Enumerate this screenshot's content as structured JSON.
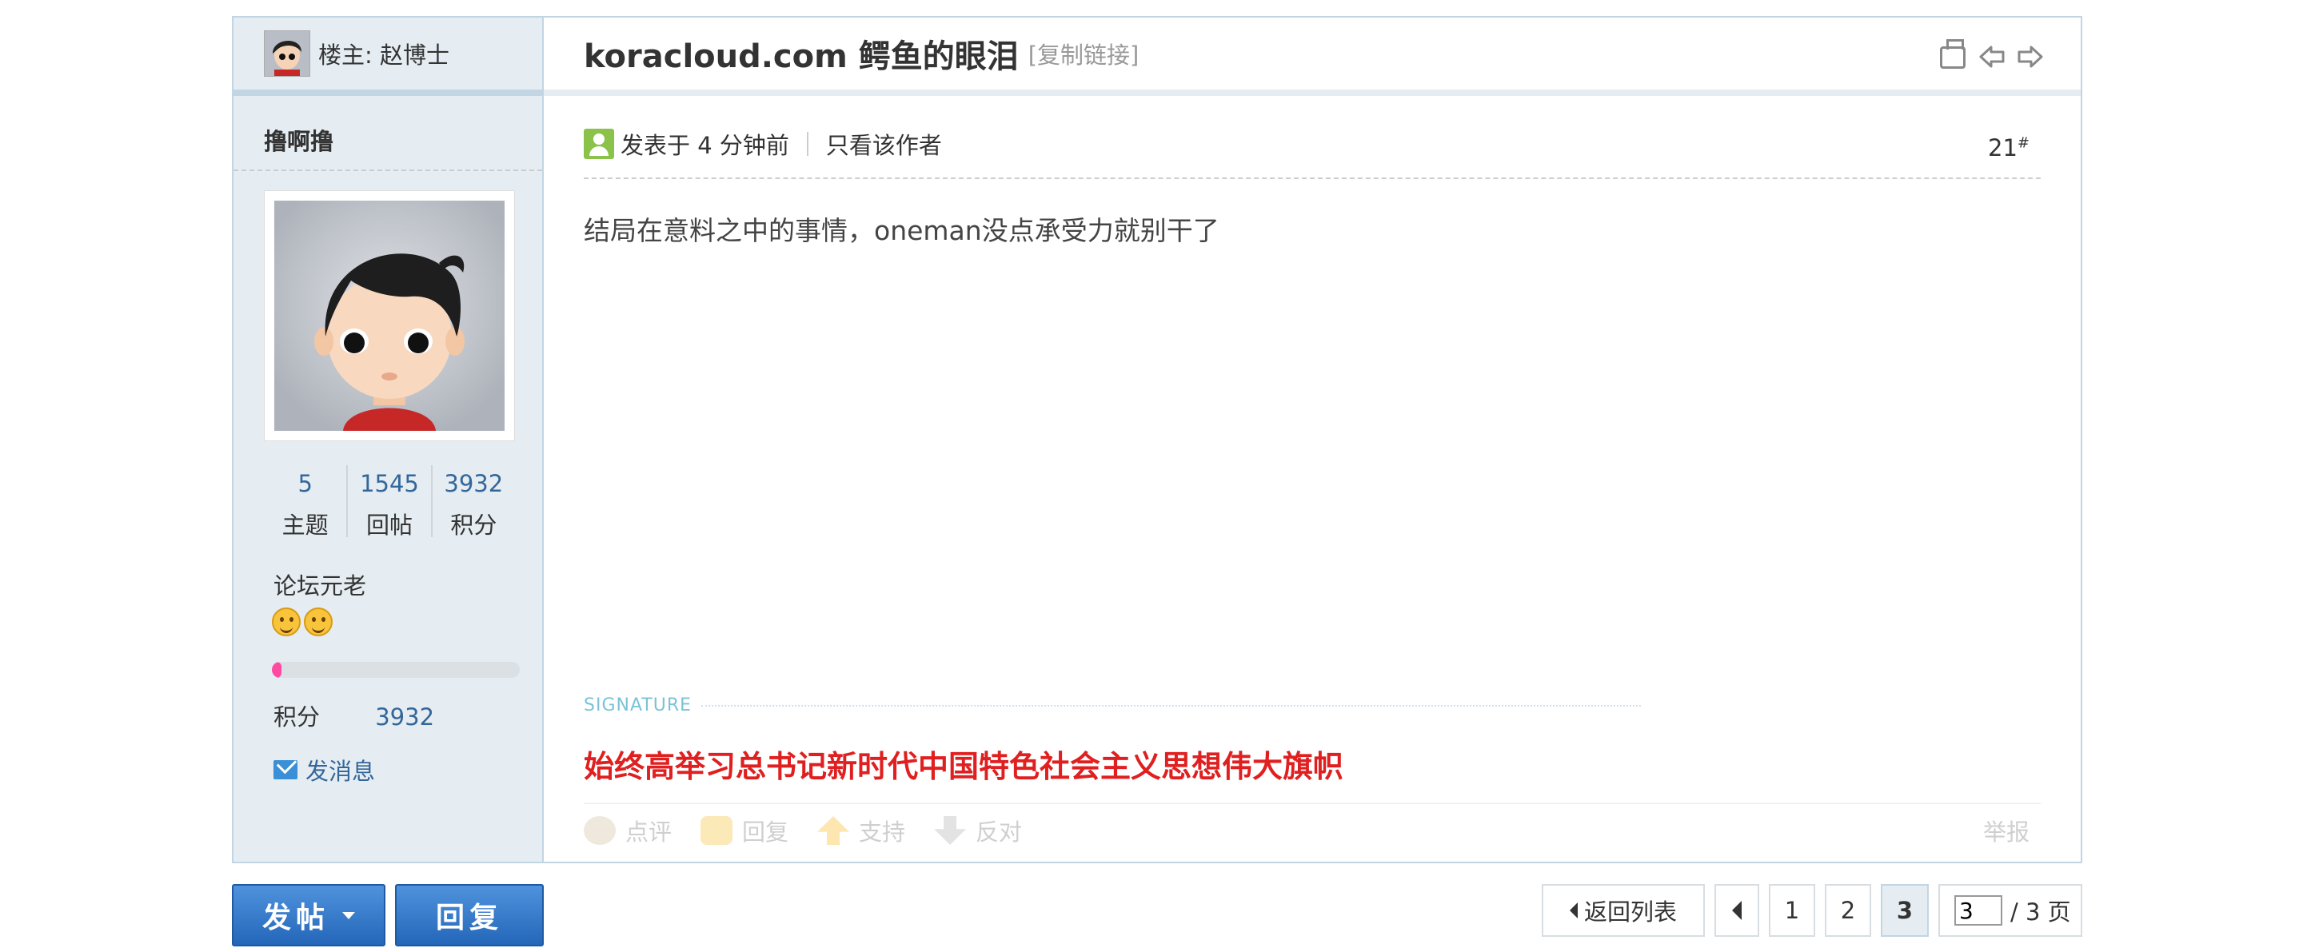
{
  "sidebar": {
    "op_label": "楼主: 赵博士",
    "author": "撸啊撸",
    "stats": [
      {
        "num": "5",
        "label": "主题"
      },
      {
        "num": "1545",
        "label": "回帖"
      },
      {
        "num": "3932",
        "label": "积分"
      }
    ],
    "rank": "论坛元老",
    "progress": 0.04,
    "points_label": "积分",
    "points_value": "3932",
    "pm_label": "发消息"
  },
  "post": {
    "title": "koracloud.com 鳄鱼的眼泪",
    "copy_link": "[复制链接]",
    "posted": "发表于 4 分钟前",
    "only_author": "只看该作者",
    "floor": "21",
    "floor_mark": "#",
    "content": "结局在意料之中的事情，oneman没点承受力就别干了",
    "signature_label": "SIGNATURE",
    "signature": "始终高举习总书记新时代中国特色社会主义思想伟大旗帜",
    "actions": {
      "comment": "点评",
      "reply": "回复",
      "support": "支持",
      "oppose": "反对",
      "report": "举报"
    }
  },
  "buttons": {
    "post": "发帖",
    "reply": "回复"
  },
  "pager": {
    "back": "返回列表",
    "pages": [
      "1",
      "2"
    ],
    "current": "3",
    "input_value": "3",
    "total": "/ 3 页"
  }
}
